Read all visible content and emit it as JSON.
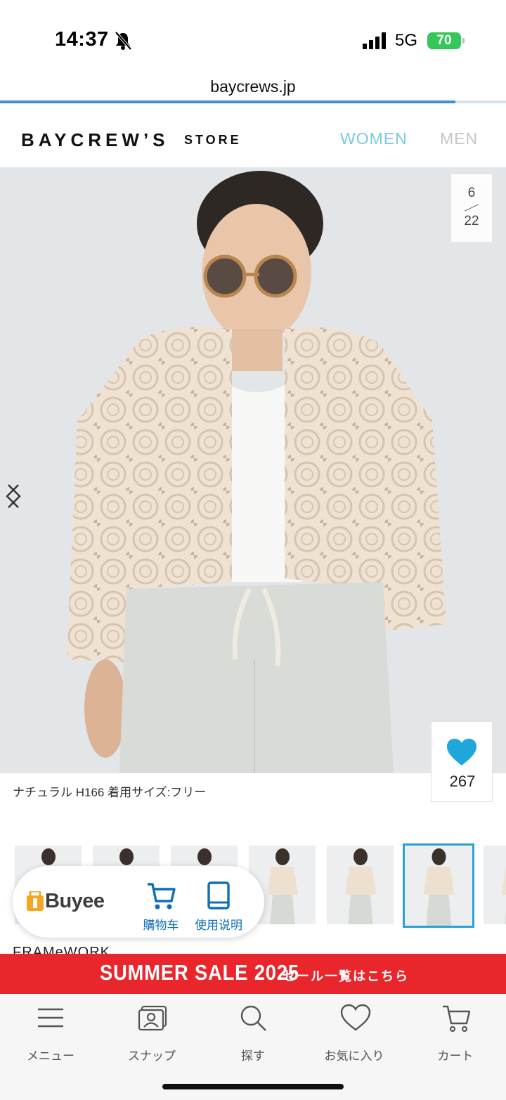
{
  "status_bar": {
    "time": "14:37",
    "network": "5G",
    "battery": "70"
  },
  "browser": {
    "url": "baycrews.jp",
    "load_progress": 0.9
  },
  "header": {
    "logo": "BAYCREW’S",
    "logo_store": "STORE",
    "nav_women": "WOMEN",
    "nav_men": "MEN",
    "accent_color": "#7ac8e4"
  },
  "gallery": {
    "current": "6",
    "total": "22",
    "caption": "ナチュラル H166 着用サイズ:フリー",
    "favorite_count": "267",
    "favorite_color": "#1ea6dd",
    "thumbnail_count": 7,
    "active_thumbnail": 6
  },
  "buyee": {
    "logo": "Buyee",
    "cart_label": "購物车",
    "guide_label": "使用说明"
  },
  "brand_peek": "FRAMeWORK",
  "sale_banner": {
    "title": "SUMMER SALE 2025",
    "link": "セール一覧はこちら",
    "color": "#e8262b"
  },
  "bottom_nav": {
    "items": [
      {
        "label": "メニュー",
        "icon": "menu-icon"
      },
      {
        "label": "スナップ",
        "icon": "snap-icon"
      },
      {
        "label": "探す",
        "icon": "search-icon"
      },
      {
        "label": "お気に入り",
        "icon": "heart-icon"
      },
      {
        "label": "カート",
        "icon": "cart-icon"
      }
    ]
  }
}
